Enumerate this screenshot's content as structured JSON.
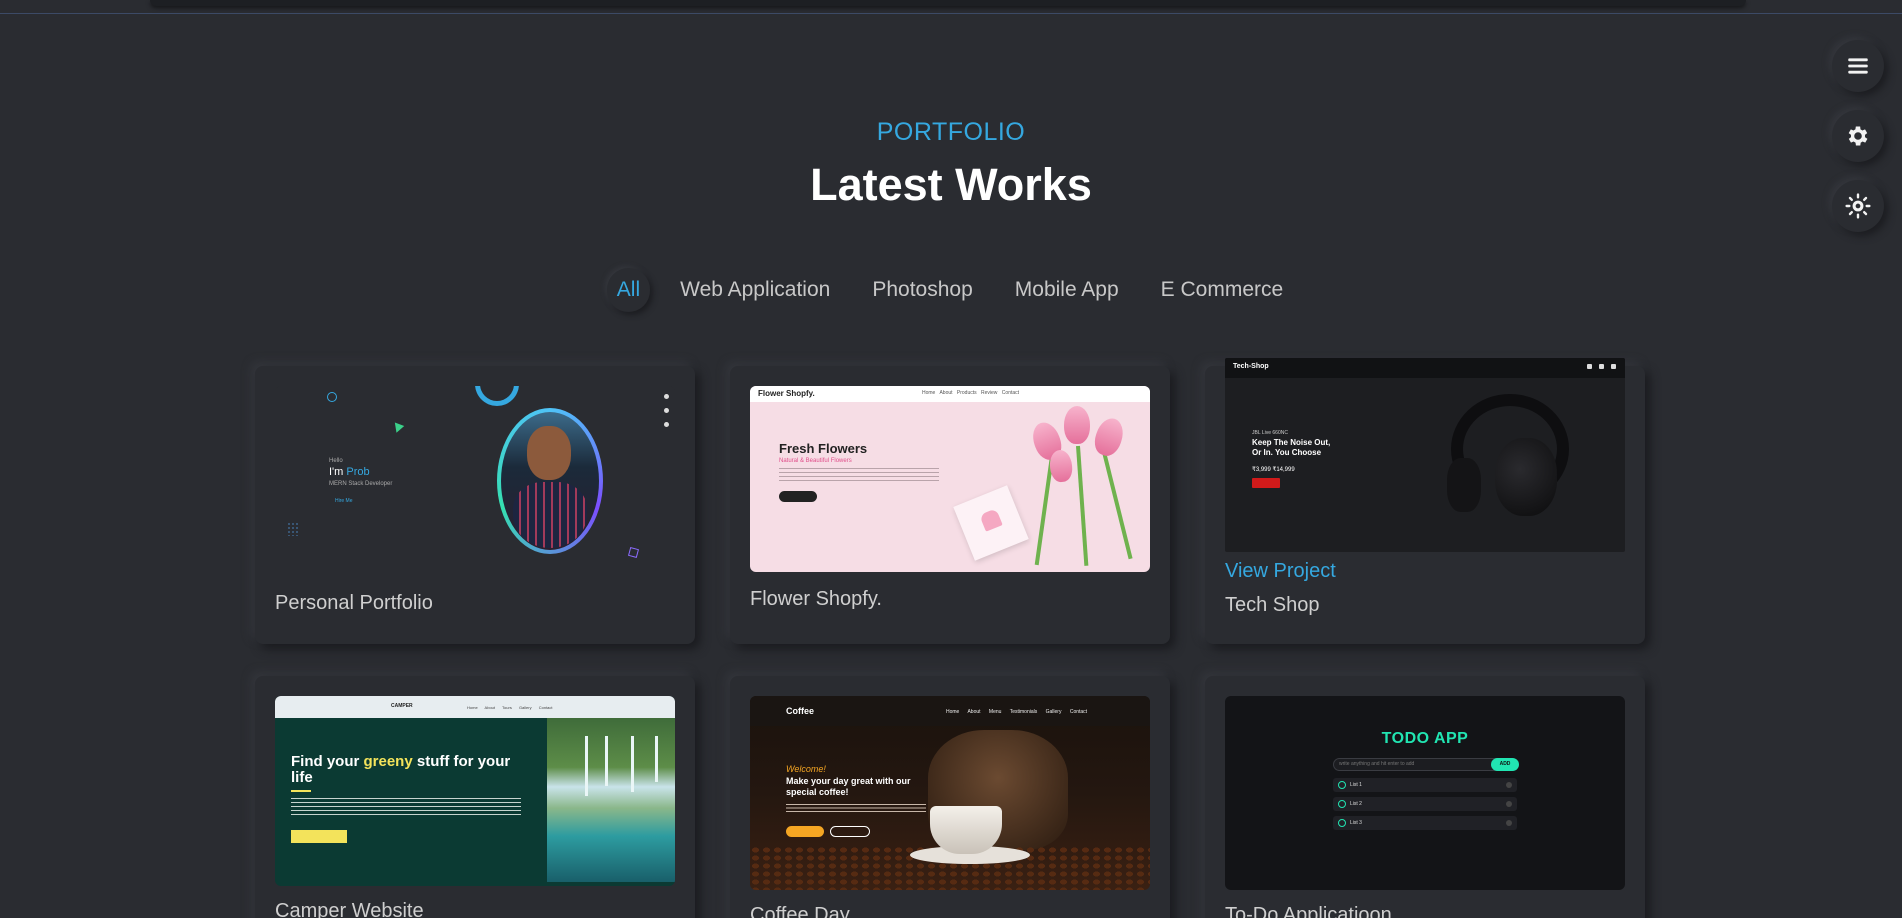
{
  "header": {
    "eyebrow": "PORTFOLIO",
    "title": "Latest Works"
  },
  "filters": [
    {
      "label": "All",
      "active": true
    },
    {
      "label": "Web Application",
      "active": false
    },
    {
      "label": "Photoshop",
      "active": false
    },
    {
      "label": "Mobile App",
      "active": false
    },
    {
      "label": "E Commerce",
      "active": false
    }
  ],
  "side_buttons": [
    {
      "icon": "menu-icon"
    },
    {
      "icon": "gear-icon"
    },
    {
      "icon": "sun-icon"
    }
  ],
  "projects": [
    {
      "title": "Personal Portfolio",
      "thumb": {
        "greeting": "Hello",
        "intro": "I'm ",
        "name_typed": "Prob",
        "role": "MERN Stack Developer",
        "cta": "Hire Me"
      }
    },
    {
      "title": "Flower Shopfy.",
      "thumb": {
        "brand": "Flower Shopfy.",
        "nav": "Home About Products Review Contact",
        "heading": "Fresh Flowers",
        "sub": "Natural & Beautiful Flowers"
      }
    },
    {
      "title": "Tech Shop",
      "link": "View Project",
      "thumb": {
        "brand": "Tech-Shop",
        "tag": "JBL Live 660NC",
        "heading_l1": "Keep The Noise Out,",
        "heading_l2": "Or In. You Choose",
        "price": "₹3,999  ₹14,999",
        "cta": "Shop Now"
      }
    },
    {
      "title": "Camper Website",
      "thumb": {
        "brand": "CAMPER",
        "nav": "Home About Tours Gallery Contact",
        "heading_pre": "Find your ",
        "heading_hl": "greeny",
        "heading_post": " stuff for your life",
        "cta": "Learn More ≫"
      }
    },
    {
      "title": "Coffee Day",
      "thumb": {
        "brand": "Coffee",
        "nav": "Home About Menu Testimonials Gallery Contact",
        "welcome": "Welcome!",
        "heading_l1": "Make your day great with our",
        "heading_l2": "special coffee!",
        "btn1": "Order Now",
        "btn2": "Contact Us"
      }
    },
    {
      "title": "To-Do Applicatioon",
      "thumb": {
        "heading": "TODO APP",
        "placeholder": "write anything and hit enter to add",
        "add": "ADD",
        "items": [
          "List 1",
          "List 2",
          "List 3"
        ]
      }
    }
  ],
  "colors": {
    "accent": "#35a8e0",
    "background": "#2a2c31",
    "todo_accent": "#21e5b2"
  }
}
